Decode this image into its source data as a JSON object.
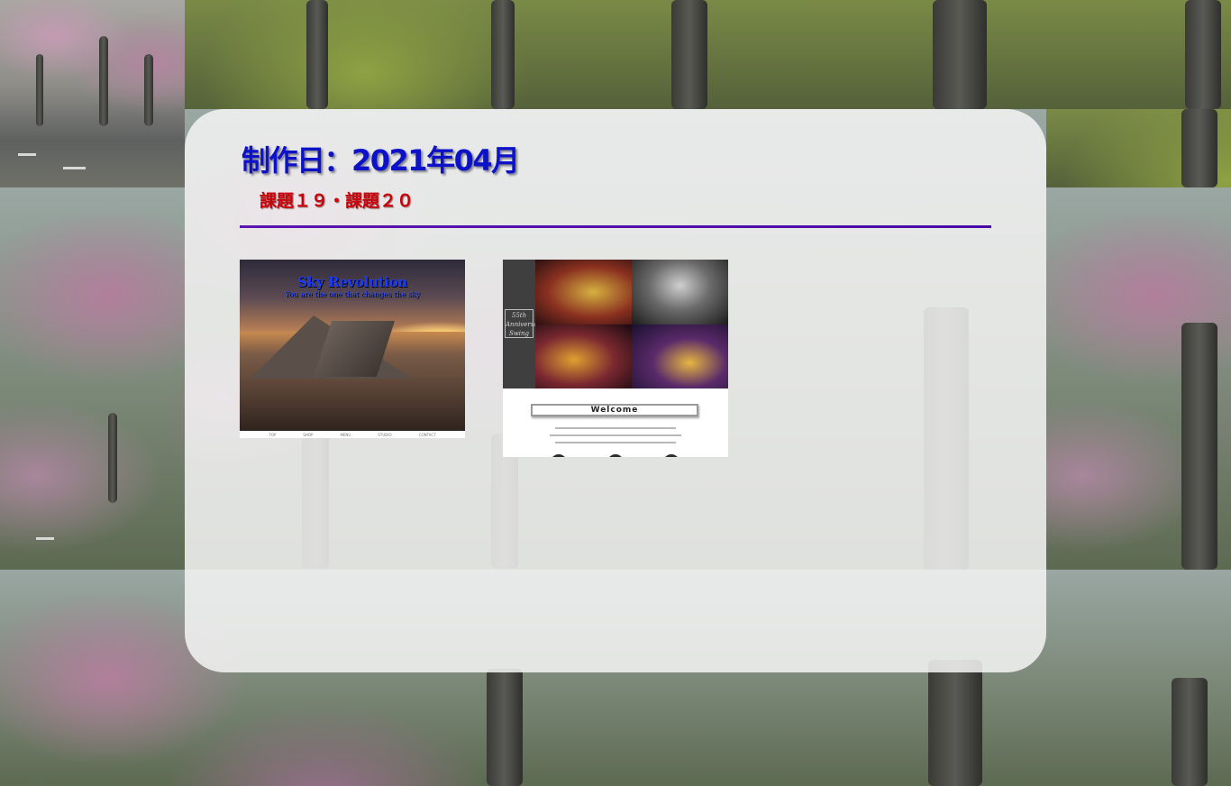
{
  "page": {
    "date_heading": "制作日：2021年04月",
    "subtitle": "課題１９・課題２０"
  },
  "works": [
    {
      "title": "Sky Revolution",
      "tagline": "You are the one that changes the sky",
      "nav": [
        "TOP",
        "SHOP",
        "MENU",
        "STUDIO",
        "CONTACT"
      ]
    },
    {
      "logo": "55th Anniversary Swing",
      "welcome": "Welcome"
    }
  ],
  "colors": {
    "heading": "#0d12c9",
    "subtitle": "#c8000a",
    "divider": "#5a14b0"
  }
}
